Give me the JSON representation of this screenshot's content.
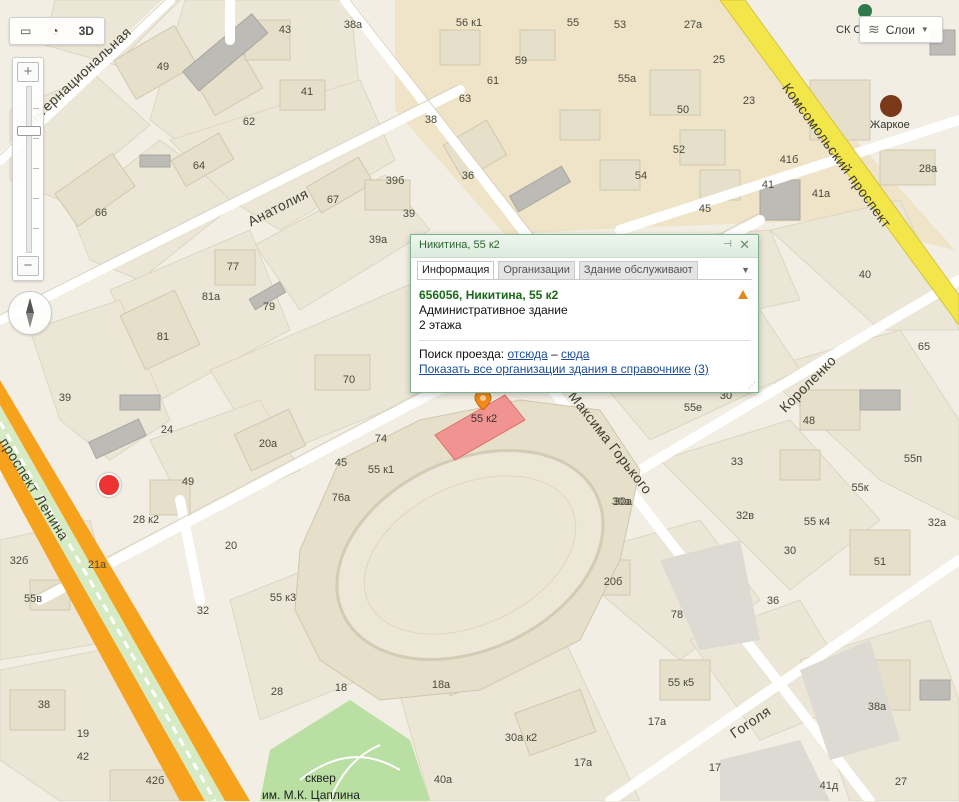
{
  "controls": {
    "view3d_label": "3D",
    "zoom_in": "+",
    "zoom_out": "−",
    "layers_label": "Слои"
  },
  "streets": {
    "internatsionalnaya": "Интернациональная",
    "anatoliya": "Анатолия",
    "komsomolsky": "Комсомольский проспект",
    "korolenko": "Короленко",
    "maksima_gorkogo": "Максима Горького",
    "prospekt_lenina": "проспект Ленина",
    "gogolya": "Гоголя"
  },
  "houses": [
    "56 к1",
    "55",
    "53",
    "27а",
    "38а",
    "43",
    "49",
    "59",
    "25",
    "61",
    "55а",
    "63",
    "50",
    "23",
    "62",
    "41",
    "38",
    "52",
    "64",
    "36",
    "41б",
    "54",
    "41",
    "28а",
    "41а",
    "66",
    "67",
    "39б",
    "39",
    "45",
    "39а",
    "77",
    "81а",
    "79",
    "40",
    "81",
    "70",
    "60",
    "65",
    "39",
    "24",
    "20а",
    "74",
    "55е",
    "30",
    "48",
    "45",
    "55 к1",
    "55п",
    "30а",
    "33",
    "49",
    "76а",
    "55к",
    "32в",
    "28 к2",
    "20",
    "55 к4",
    "32а",
    "30",
    "32б",
    "21а",
    "20б",
    "51",
    "32",
    "55 к3",
    "55в",
    "78",
    "36",
    "28",
    "18",
    "18а",
    "55 к5",
    "38",
    "19",
    "17а",
    "38а",
    "30а к2",
    "42",
    "17а",
    "40а",
    "42б",
    "17",
    "41д",
    "27",
    "32"
  ],
  "pois": {
    "sk": "СК С",
    "zharkoe": "Жаркое",
    "square_1": "сквер",
    "square_2": "им. М.К. Цаплина"
  },
  "popup": {
    "title": "Никитина, 55 к2",
    "tabs": [
      "Информация",
      "Организации",
      "Здание обслуживают"
    ],
    "address": "656056, Никитина, 55 к2",
    "type": "Административное здание",
    "floors": "2 этажа",
    "route_label": "Поиск проезда:",
    "route_from": "отсюда",
    "route_dash": "–",
    "route_to": "сюда",
    "orgs_link": "Показать все организации здания в справочнике",
    "orgs_count": "(3)"
  },
  "marker_label": "55 к2",
  "colors": {
    "background": "#f2eee3",
    "block_dark": "#ebe5d4",
    "block_tan": "#efe3c8",
    "building": "#e6dfc9",
    "road_major": "#f7a21c",
    "road_yellow": "#f2e64a",
    "park": "#b9dfa3",
    "highlight": "#f28b8b",
    "popup_border": "#7fb38f"
  }
}
